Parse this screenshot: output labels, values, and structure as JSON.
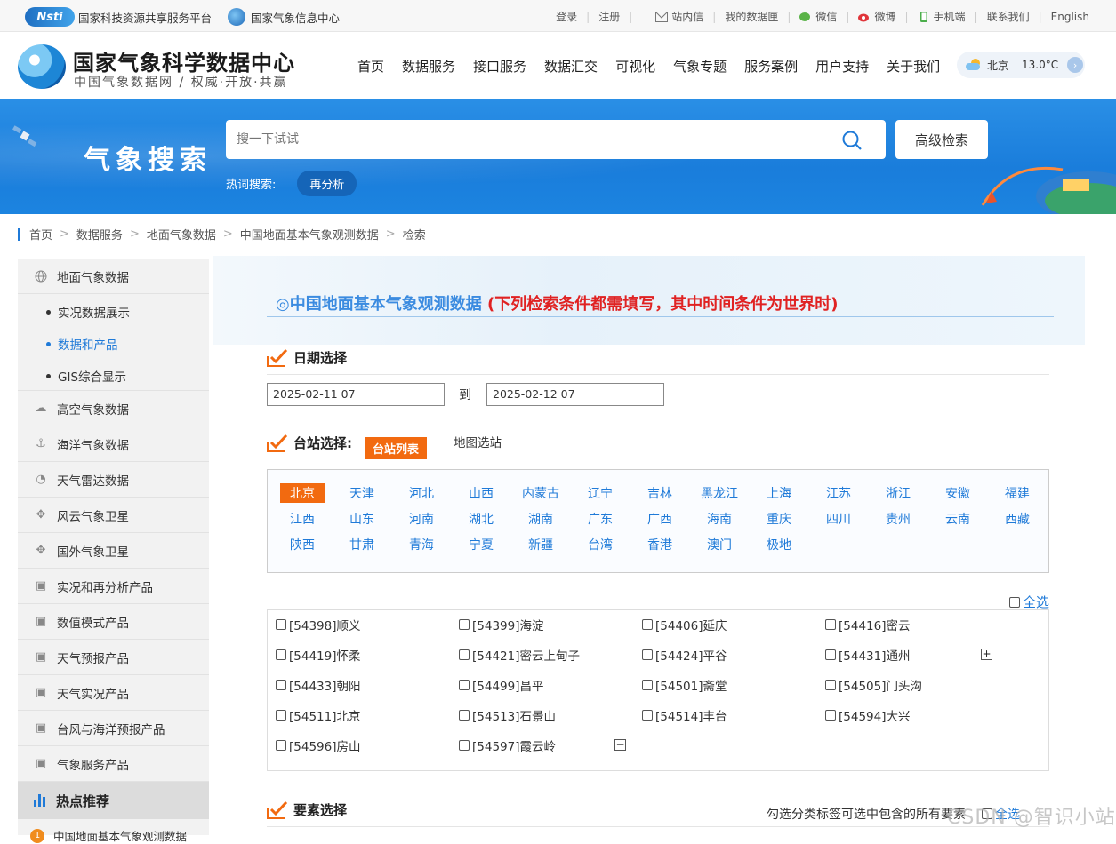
{
  "topbar": {
    "nsti_logo": "Nsti",
    "platform": "国家科技资源共享服务平台",
    "cma": "国家气象信息中心",
    "login": "登录",
    "register": "注册",
    "mail": "站内信",
    "my_data": "我的数据匣",
    "wechat": "微信",
    "weibo": "微博",
    "mobile": "手机端",
    "contact": "联系我们",
    "english": "English"
  },
  "header": {
    "site_title": "国家气象科学数据中心",
    "site_sub": "中国气象数据网 / 权威·开放·共赢",
    "nav": [
      "首页",
      "数据服务",
      "接口服务",
      "数据汇交",
      "可视化",
      "气象专题",
      "服务案例",
      "用户支持",
      "关于我们"
    ],
    "weather_city": "北京",
    "weather_temp": "13.0°C"
  },
  "banner": {
    "title": "气象搜索",
    "search_placeholder": "搜一下试试",
    "advanced": "高级检索",
    "hot_label": "热词搜索:",
    "hot_tag": "再分析"
  },
  "breadcrumb": [
    "首页",
    "数据服务",
    "地面气象数据",
    "中国地面基本气象观测数据",
    "检索"
  ],
  "sidebar": {
    "cat1": "地面气象数据",
    "subs": [
      "实况数据展示",
      "数据和产品",
      "GIS综合显示"
    ],
    "cats": [
      "高空气象数据",
      "海洋气象数据",
      "天气雷达数据",
      "风云气象卫星",
      "国外气象卫星",
      "实况和再分析产品",
      "数值模式产品",
      "天气预报产品",
      "天气实况产品",
      "台风与海洋预报产品",
      "气象服务产品"
    ],
    "hot": "热点推荐",
    "hot_first": "中国地面基本气象观测数据"
  },
  "main": {
    "title": "◎中国地面基本气象观测数据",
    "title_note": "(下列检索条件都需填写，其中时间条件为世界时)",
    "date_section": "日期选择",
    "date_start": "2025-02-11 07",
    "date_to": "到",
    "date_end": "2025-02-12 07",
    "station_section": "台站选择:",
    "tab_list": "台站列表",
    "tab_map": "地图选站",
    "provinces": [
      "北京",
      "天津",
      "河北",
      "山西",
      "内蒙古",
      "辽宁",
      "吉林",
      "黑龙江",
      "上海",
      "江苏",
      "浙江",
      "安徽",
      "福建",
      "江西",
      "山东",
      "河南",
      "湖北",
      "湖南",
      "广东",
      "广西",
      "海南",
      "重庆",
      "四川",
      "贵州",
      "云南",
      "西藏",
      "陕西",
      "甘肃",
      "青海",
      "宁夏",
      "新疆",
      "台湾",
      "香港",
      "澳门",
      "极地"
    ],
    "select_all": "全选",
    "stations": [
      "[54398]顺义",
      "[54399]海淀",
      "[54406]延庆",
      "[54416]密云",
      "[54419]怀柔",
      "[54421]密云上甸子",
      "[54424]平谷",
      "[54431]通州",
      "[54433]朝阳",
      "[54499]昌平",
      "[54501]斋堂",
      "[54505]门头沟",
      "[54511]北京",
      "[54513]石景山",
      "[54514]丰台",
      "[54594]大兴",
      "[54596]房山",
      "[54597]霞云岭"
    ],
    "plus": "+",
    "minus": "−",
    "element_section": "要素选择",
    "element_hint": "勾选分类标签可选中包含的所有要素",
    "element_selall": "全选"
  },
  "watermark": "CSDN @智识小站"
}
